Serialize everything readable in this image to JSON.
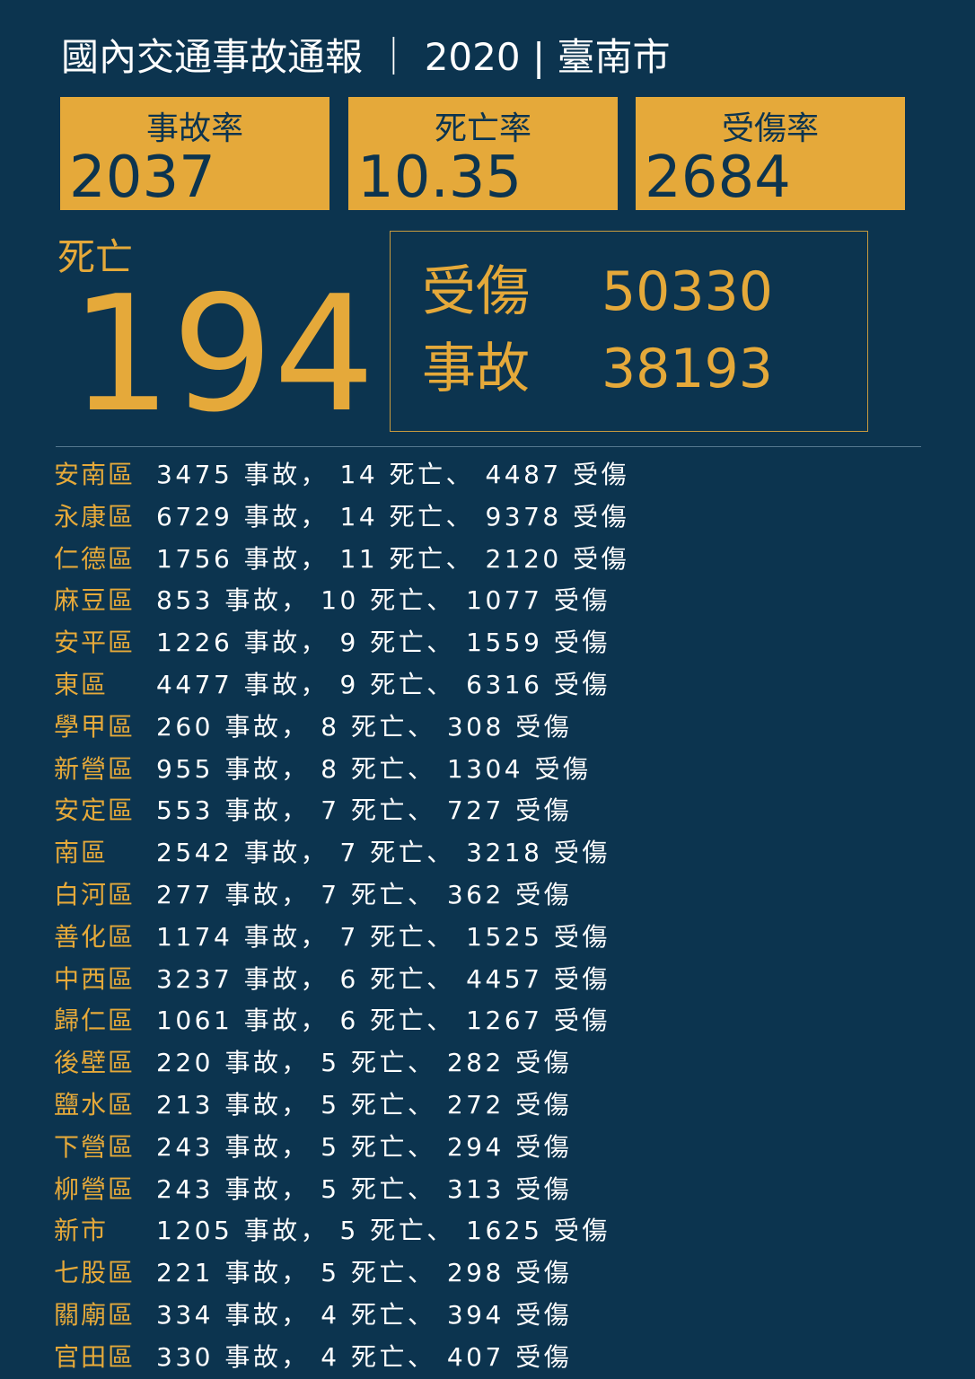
{
  "title": "國內交通事故通報 ｜ 2020 | 臺南市",
  "kpis": [
    {
      "label": "事故率",
      "value": "2037"
    },
    {
      "label": "死亡率",
      "value": "10.35"
    },
    {
      "label": "受傷率",
      "value": "2684"
    }
  ],
  "deaths": {
    "label": "死亡",
    "value": "194"
  },
  "stats": [
    {
      "label": "受傷",
      "value": "50330"
    },
    {
      "label": "事故",
      "value": "38193"
    }
  ],
  "districts": [
    {
      "name": "安南區",
      "text": "3475 事故， 14 死亡、 4487 受傷"
    },
    {
      "name": "永康區",
      "text": "6729 事故， 14 死亡、 9378 受傷"
    },
    {
      "name": "仁德區",
      "text": "1756 事故， 11 死亡、 2120 受傷"
    },
    {
      "name": "麻豆區",
      "text": "853 事故， 10 死亡、 1077 受傷"
    },
    {
      "name": "安平區",
      "text": "1226 事故， 9 死亡、 1559 受傷"
    },
    {
      "name": "東區",
      "text": "4477 事故， 9 死亡、 6316 受傷"
    },
    {
      "name": "學甲區",
      "text": "260 事故， 8 死亡、 308 受傷"
    },
    {
      "name": "新營區",
      "text": "955 事故， 8 死亡、 1304 受傷"
    },
    {
      "name": "安定區",
      "text": "553 事故， 7 死亡、 727 受傷"
    },
    {
      "name": "南區",
      "text": "2542 事故， 7 死亡、 3218 受傷"
    },
    {
      "name": "白河區",
      "text": "277 事故， 7 死亡、 362 受傷"
    },
    {
      "name": "善化區",
      "text": "1174 事故， 7 死亡、 1525 受傷"
    },
    {
      "name": "中西區",
      "text": "3237 事故， 6 死亡、 4457 受傷"
    },
    {
      "name": "歸仁區",
      "text": "1061 事故， 6 死亡、 1267 受傷"
    },
    {
      "name": "後壁區",
      "text": "220 事故， 5 死亡、 282 受傷"
    },
    {
      "name": "鹽水區",
      "text": "213 事故， 5 死亡、 272 受傷"
    },
    {
      "name": "下營區",
      "text": "243 事故， 5 死亡、 294 受傷"
    },
    {
      "name": "柳營區",
      "text": "243 事故， 5 死亡、 313 受傷"
    },
    {
      "name": "新市",
      "text": "1205 事故， 5 死亡、 1625 受傷"
    },
    {
      "name": "七股區",
      "text": "221 事故， 5 死亡、 298 受傷"
    },
    {
      "name": "關廟區",
      "text": "334 事故， 4 死亡、 394 受傷"
    },
    {
      "name": "官田區",
      "text": "330 事故， 4 死亡、 407 受傷"
    }
  ],
  "colors": {
    "background": "#0c344f",
    "accent": "#e5a93a",
    "text": "#ffffff"
  }
}
